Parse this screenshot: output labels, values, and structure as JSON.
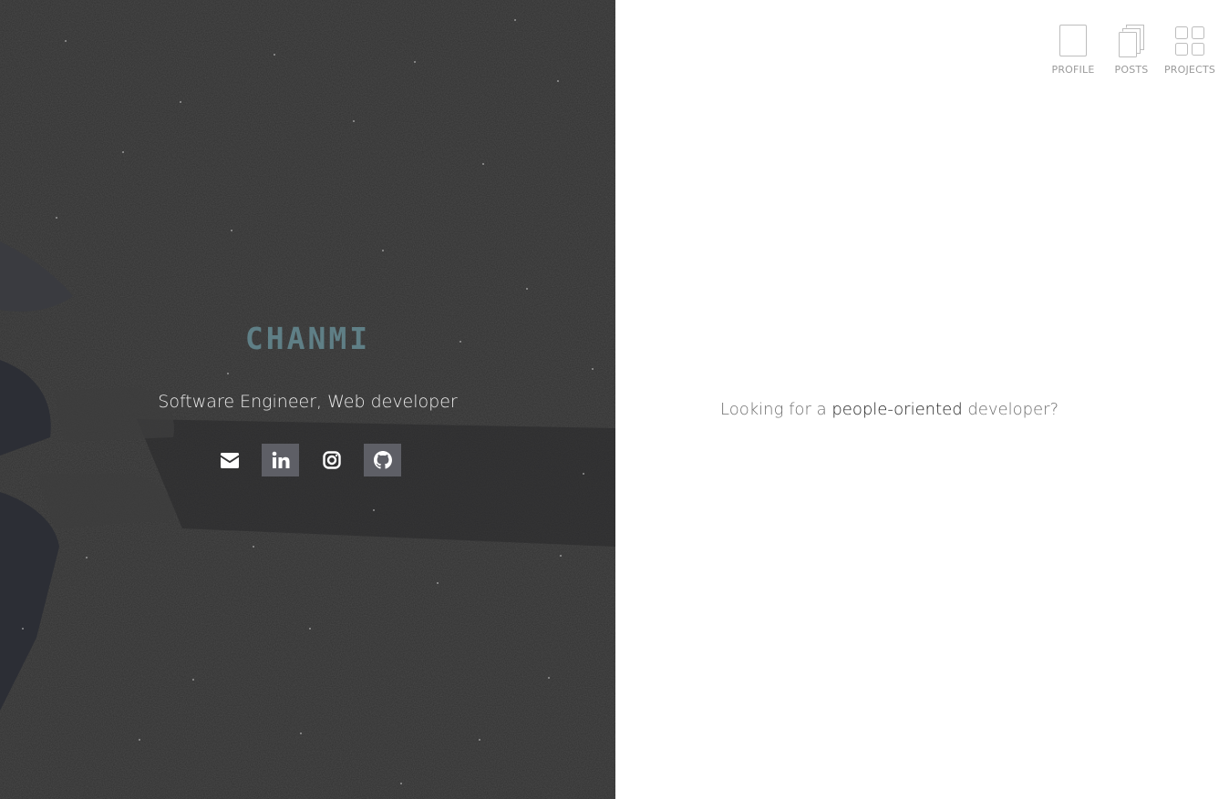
{
  "hero": {
    "brand": "CHANMI",
    "tagline": "Software Engineer, Web developer",
    "background_color": "#333333",
    "brand_color": "#5f7f86",
    "socials": [
      {
        "icon": "envelope-icon",
        "style": "plain"
      },
      {
        "icon": "linkedin-icon",
        "style": "filled"
      },
      {
        "icon": "instagram-icon",
        "style": "plain"
      },
      {
        "icon": "github-icon",
        "style": "filled"
      }
    ]
  },
  "nav": {
    "items": [
      {
        "label": "PROFILE",
        "icon": "page-icon"
      },
      {
        "label": "POSTS",
        "icon": "stacked-pages-icon"
      },
      {
        "label": "PROJECTS",
        "icon": "grid-icon"
      }
    ]
  },
  "intro": {
    "prefix": "Looking for a ",
    "emphasis": "people-oriented",
    "suffix": " developer?"
  }
}
